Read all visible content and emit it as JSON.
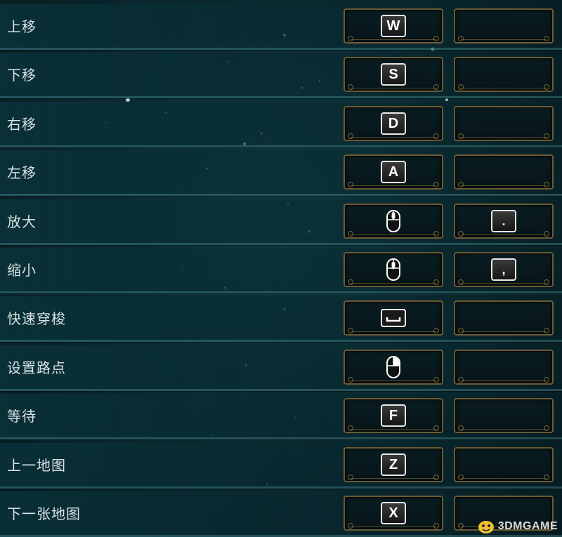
{
  "keybinds": [
    {
      "action": "上移",
      "primary": {
        "type": "key",
        "label": "W"
      },
      "secondary": null
    },
    {
      "action": "下移",
      "primary": {
        "type": "key",
        "label": "S"
      },
      "secondary": null
    },
    {
      "action": "右移",
      "primary": {
        "type": "key",
        "label": "D"
      },
      "secondary": null
    },
    {
      "action": "左移",
      "primary": {
        "type": "key",
        "label": "A"
      },
      "secondary": null
    },
    {
      "action": "放大",
      "primary": {
        "type": "mouse",
        "button": "scroll-up"
      },
      "secondary": {
        "type": "key",
        "label": "."
      }
    },
    {
      "action": "缩小",
      "primary": {
        "type": "mouse",
        "button": "scroll-down"
      },
      "secondary": {
        "type": "key",
        "label": ","
      }
    },
    {
      "action": "快速穿梭",
      "primary": {
        "type": "space"
      },
      "secondary": null
    },
    {
      "action": "设置路点",
      "primary": {
        "type": "mouse",
        "button": "right-click"
      },
      "secondary": null
    },
    {
      "action": "等待",
      "primary": {
        "type": "key",
        "label": "F"
      },
      "secondary": null
    },
    {
      "action": "上一地图",
      "primary": {
        "type": "key",
        "label": "Z"
      },
      "secondary": null
    },
    {
      "action": "下一张地图",
      "primary": {
        "type": "key",
        "label": "X"
      },
      "secondary": null
    }
  ],
  "watermark": {
    "text": "3DMGAME",
    "icon": "3dm-logo-icon"
  },
  "colors": {
    "background": "#0a2a30",
    "row_divider": "#5aa0aa",
    "slot_border": "#6b5a34",
    "label_text": "#d8e2e4",
    "key_border": "#e8e8e8"
  }
}
